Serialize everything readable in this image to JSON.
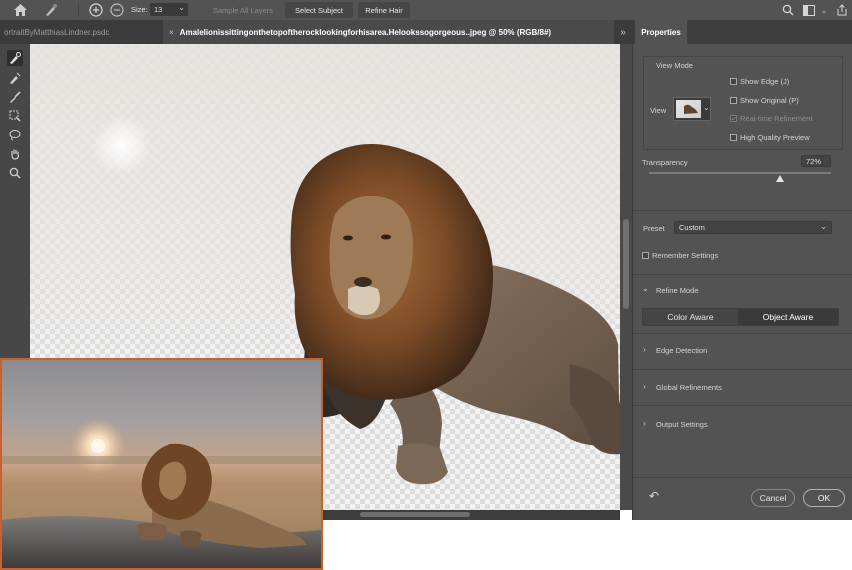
{
  "toolbar": {
    "size_label": "Size:",
    "size_value": "13",
    "sample_all_layers": "Sample All Layers",
    "select_subject": "Select Subject",
    "refine_hair": "Refine Hair"
  },
  "tabs": [
    {
      "label": "ortraitByMatthiasLindner.psdc",
      "active": false
    },
    {
      "label": "Amalelionissittingonthetopoftherocklookingforhisarea.Helookssogorgeous..jpeg @ 50% (RGB/8#)",
      "active": true
    }
  ],
  "tabs_close": "×",
  "panel_toggle": "»",
  "properties": {
    "title": "Properties",
    "view_mode": {
      "heading": "View Mode",
      "view_label": "View",
      "options": [
        {
          "label": "Show Edge (J)",
          "checked": false,
          "disabled": false
        },
        {
          "label": "Show Original (P)",
          "checked": false,
          "disabled": false
        },
        {
          "label": "Real-time Refinement",
          "checked": true,
          "disabled": true
        },
        {
          "label": "High Quality Preview",
          "checked": false,
          "disabled": false
        }
      ]
    },
    "transparency": {
      "label": "Transparency",
      "value": "72%",
      "level": 0.72
    },
    "preset": {
      "label": "Preset",
      "value": "Custom"
    },
    "remember_settings": "Remember Settings",
    "refine_mode": {
      "label": "Refine Mode",
      "options": [
        "Color Aware",
        "Object Aware"
      ],
      "selected": "Object Aware"
    },
    "sections": [
      "Edge Detection",
      "Global Refinements",
      "Output Settings"
    ],
    "cancel": "Cancel",
    "ok": "OK"
  },
  "icons": {
    "home": "⌂",
    "search": "⌕",
    "tool_add": "+",
    "tool_sub": "−",
    "chev_down": "⌄",
    "chev_right": "›",
    "chev_open": "⌄",
    "undo": "↶"
  },
  "colors": {
    "accent_border": "#c8622c",
    "panel_bg": "#535353"
  }
}
